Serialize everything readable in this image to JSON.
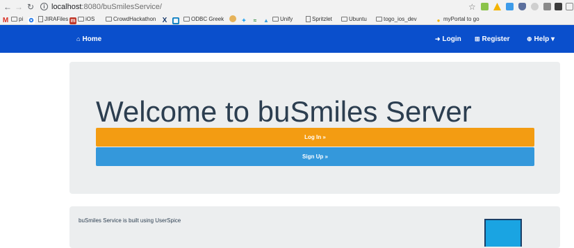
{
  "browser": {
    "url_host": "localhost",
    "url_path": ":8080/buSmilesService/",
    "bookmarks": [
      {
        "label": "pi",
        "kind": "folder"
      },
      {
        "label": "JIRAFiles",
        "kind": "page"
      },
      {
        "label": "iOS",
        "kind": "folder"
      },
      {
        "label": "CrowdHackathon",
        "kind": "folder"
      },
      {
        "label": "ODBC Greek",
        "kind": "folder"
      },
      {
        "label": "Unify",
        "kind": "folder"
      },
      {
        "label": "Spritzlet",
        "kind": "page"
      },
      {
        "label": "Ubuntu",
        "kind": "folder"
      },
      {
        "label": "togo_ios_dev",
        "kind": "folder"
      },
      {
        "label": "myPortal to go",
        "kind": "page"
      }
    ]
  },
  "navbar": {
    "home": "Home",
    "login": "Login",
    "register": "Register",
    "help": "Help ▾",
    "color": "#0a4fcc"
  },
  "jumbotron": {
    "title": "Welcome to buSmiles Server",
    "login_button": "Log In »",
    "signup_button": "Sign Up »",
    "login_color": "#f39c12",
    "signup_color": "#3498db"
  },
  "panel": {
    "text": "buSmiles Service is built using UserSpice"
  }
}
